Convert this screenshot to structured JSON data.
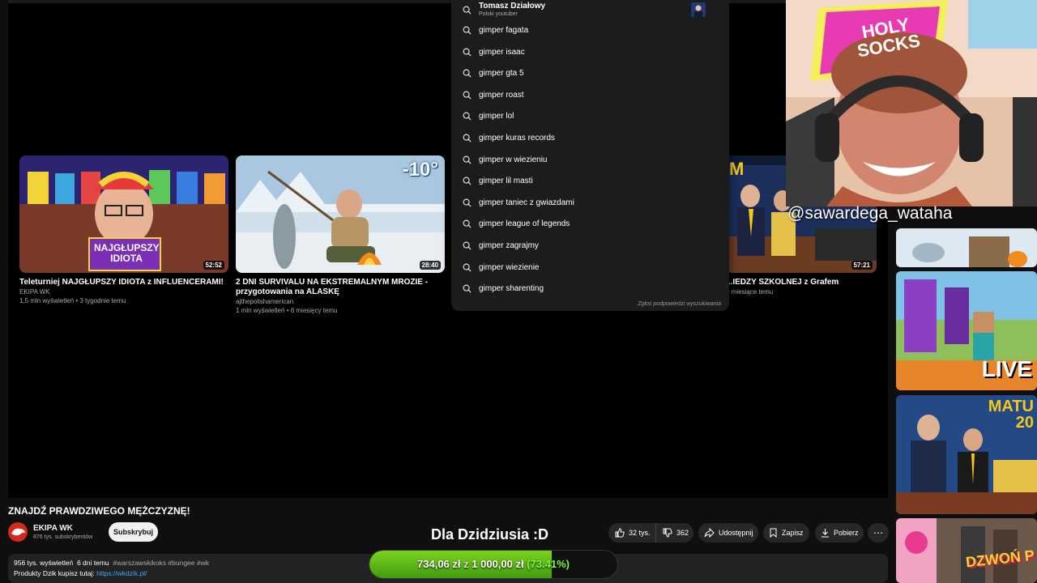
{
  "cards": [
    {
      "title": "Teleturniej NAJGŁUPSZY IDIOTA z INFLUENCERAMI!",
      "channel": "EKIPA WK",
      "meta": "1,5 mln wyświetleń • 3 tygodnie temu",
      "duration": "52:52",
      "thumb_text": "NAJGŁUPSZY IDIOTA"
    },
    {
      "title": "2 DNI SURVIVALU NA EKSTREMALNYM MROZIE - przygotowania na ALASKĘ",
      "channel": "ajthepolishamerican",
      "meta": "1 mln wyświetleń • 6 miesięcy temu",
      "duration": "28:40",
      "thumb_text": "-10°"
    },
    {
      "title": "...IEDZY SZKOLNEJ z Grafem",
      "channel": "",
      "meta": "3 miesiące temu",
      "duration": "57:21",
      "thumb_text": "M"
    }
  ],
  "search": {
    "top": {
      "name": "Tomasz Działowy",
      "sub": "Polski youtuber"
    },
    "suggestions": [
      "gimper fagata",
      "gimper isaac",
      "gimper gta 5",
      "gimper roast",
      "gimper lol",
      "gimper kuras records",
      "gimper w wiezieniu",
      "gimper lil masti",
      "gimper taniec z gwiazdami",
      "gimper league of legends",
      "gimper zagrajmy",
      "gimper wiezienie",
      "gimper sharenting"
    ],
    "report": "Zgłoś podpowiedzi wyszukiwania"
  },
  "webcam": {
    "handle": "@sawardega_wataha",
    "sign_text": "HOLY SOCKS"
  },
  "sidebar": [
    {
      "caption": ""
    },
    {
      "caption": "LIVE"
    },
    {
      "caption": "MATU 20"
    },
    {
      "caption": "DZWOŃ P"
    }
  ],
  "video": {
    "title": "ZNAJDŹ PRAWDZIWEGO MĘŻCZYZNĘ!",
    "channel": "EKIPA WK",
    "subscribers": "876 tys. subskrybentów",
    "subscribe_label": "Subskrybuj",
    "likes": "32 tys.",
    "dislikes": "362",
    "share_label": "Udostępnij",
    "save_label": "Zapisz",
    "download_label": "Pobierz",
    "more_label": "⋯",
    "views": "956 tys. wyświetleń",
    "date": "6 dni temu",
    "hashtags": "#warszawskikoks #bungee #wk",
    "desc_text": "Produkty Dzik kupisz tutaj:",
    "desc_link": "https://wkdzik.pl/"
  },
  "overlay": {
    "caption": "Dla Dzidziusia :D",
    "amount": "734,06 zł",
    "of": "z",
    "goal": "1 000,00 zł",
    "percent_text": "(73.41%)",
    "progress": 0.7341
  },
  "colors": {
    "accent": "#3ea6ff",
    "progress": "#6ac11a",
    "brand": "#d32a1e"
  }
}
